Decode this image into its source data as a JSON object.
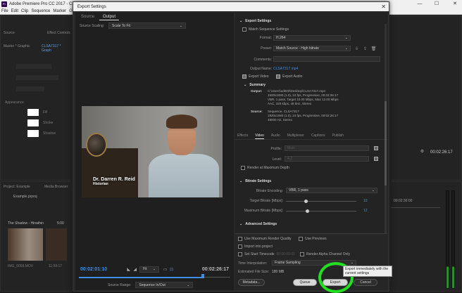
{
  "app": {
    "title": "Adobe Premiere Pro CC 2017 - C:\\Us",
    "menus": [
      "File",
      "Edit",
      "Clip",
      "Sequence",
      "Marker",
      "Grap"
    ],
    "window_controls": [
      "—",
      "☐",
      "✕"
    ]
  },
  "background": {
    "source_tab": "Source",
    "effect_controls_tab": "Effect Controls",
    "master_label": "Master * Graphic",
    "seq_label": "CLSA7317 * Graph",
    "appearance_label": "Appearance",
    "fill_label": "Fill",
    "stroke_label": "Stroke",
    "shadow_label": "Shadow",
    "project_tab": "Project: Example",
    "media_browser_tab": "Media Browser",
    "project_file": "Example.prproj",
    "clip_name": "The Shadow - Hinathin",
    "clip_duration": "5:00",
    "clip_file": "IMG_0058.MOV",
    "clip_time": "11:59:17",
    "right_timecode": "00:02:26:17",
    "timeline_timecode": "00:02:30:00"
  },
  "dialog": {
    "title": "Export Settings",
    "close": "✕",
    "left": {
      "tabs": [
        "Source",
        "Output"
      ],
      "active_tab": "Output",
      "source_scaling_label": "Source Scaling:",
      "source_scaling_value": "Scale To Fit",
      "lower_third_name": "Dr. Darren R. Reid",
      "lower_third_role": "Historian",
      "current_timecode": "00:02:01:10",
      "fit_label": "Fit",
      "end_timecode": "00:02:26:17",
      "playhead_fraction": 0.82,
      "source_range_label": "Source Range:",
      "source_range_value": "Sequence In/Out"
    },
    "export_settings": {
      "section": "Export Settings",
      "match_sequence_label": "Match Sequence Settings",
      "format_label": "Format:",
      "format_value": "H.264",
      "preset_label": "Preset:",
      "preset_value": "Match Source - High bitrate",
      "comments_label": "Comments:",
      "output_name_label": "Output Name:",
      "output_name_value": "CLSA7317.mp4",
      "export_video_label": "Export Video",
      "export_audio_label": "Export Audio"
    },
    "summary": {
      "section": "Summary",
      "output_label": "Output:",
      "output_lines": [
        "C:\\Users\\ud003\\Desktop\\CLSA7317.mp4",
        "1920x1080 (1.0), 24 fps, Progressive, 00:02:26:17",
        "VBR, 1 pass, Target 10.00 Mbps, Max 12.00 Mbps",
        "AAC, 320 kbps, 48 kHz, Stereo"
      ],
      "source_label": "Source:",
      "source_lines": [
        "Sequence, CLSA7317",
        "1920x1080 (1.0), 24 fps, Progressive, 00:02:26:17",
        "48000 Hz, Stereo"
      ]
    },
    "sub_tabs": [
      "Effects",
      "Video",
      "Audio",
      "Multiplexer",
      "Captions",
      "Publish"
    ],
    "active_sub_tab": "Video",
    "video": {
      "profile_label": "Profile:",
      "profile_value": "Main",
      "level_label": "Level:",
      "level_value": "4.2",
      "render_max_depth": "Render at Maximum Depth"
    },
    "bitrate": {
      "section": "Bitrate Settings",
      "encoding_label": "Bitrate Encoding:",
      "encoding_value": "VBR, 1 pass",
      "target_label": "Target Bitrate [Mbps]:",
      "target_value": "10",
      "target_fraction": 0.28,
      "max_label": "Maximum Bitrate [Mbps]:",
      "max_value": "12",
      "max_fraction": 0.3
    },
    "advanced": {
      "section": "Advanced Settings"
    },
    "bottom": {
      "use_max_render_quality": "Use Maximum Render Quality",
      "use_previews": "Use Previews",
      "import_into_project": "Import into project",
      "set_start_timecode": "Set Start Timecode",
      "start_timecode_value": "00:00:00:00",
      "render_alpha_only": "Render Alpha Channel Only",
      "time_interpolation_label": "Time Interpolation:",
      "time_interpolation_value": "Frame Sampling",
      "estimated_size_label": "Estimated File Size:",
      "estimated_size_value": "180 MB",
      "metadata_button": "Metadata...",
      "queue_button": "Queue",
      "export_button": "Export",
      "cancel_button": "Cancel"
    },
    "tooltip": "Export immediately with the current settings"
  },
  "colors": {
    "accent_blue": "#3d8ee8",
    "highlight_green": "#22e01f"
  }
}
